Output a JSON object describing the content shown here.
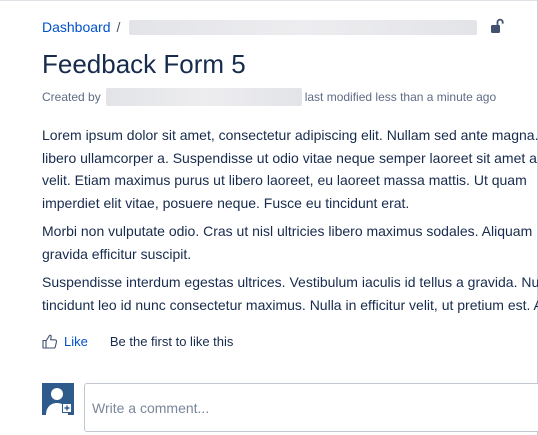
{
  "breadcrumb": {
    "root": "Dashboard",
    "separator": "/"
  },
  "page": {
    "title": "Feedback Form 5",
    "byline": {
      "prefix": "Created by",
      "suffix": "last modified less than a minute ago"
    }
  },
  "content": {
    "paragraphs": [
      {
        "lines": [
          "Lorem ipsum dolor sit amet, consectetur adipiscing elit. Nullam sed ante magna.",
          "libero ullamcorper a. Suspendisse ut odio vitae neque semper laoreet sit amet a",
          "velit. Etiam maximus purus ut libero laoreet, eu laoreet massa mattis. Ut quam",
          "imperdiet elit vitae, posuere neque. Fusce eu tincidunt erat."
        ]
      },
      {
        "lines": [
          "Morbi non vulputate odio. Cras ut nisl ultricies libero maximus sodales. Aliquam",
          "gravida efficitur suscipit."
        ]
      },
      {
        "lines": [
          "Suspendisse interdum egestas ultrices. Vestibulum iaculis id tellus a gravida. Nu",
          "tincidunt leo id nunc consectetur maximus. Nulla in efficitur velit, ut pretium est. A"
        ]
      }
    ]
  },
  "likes": {
    "label": "Like",
    "hint": "Be the first to like this"
  },
  "comment": {
    "placeholder": "Write a comment..."
  },
  "icons": {
    "lock": "unlocked-padlock-icon",
    "like": "thumbs-up-icon",
    "avatar": "default-user-avatar-icon"
  },
  "colors": {
    "link": "#0052cc",
    "avatar_bg": "#2f5b8c",
    "text": "#172b4d",
    "muted": "#5e6c84"
  }
}
